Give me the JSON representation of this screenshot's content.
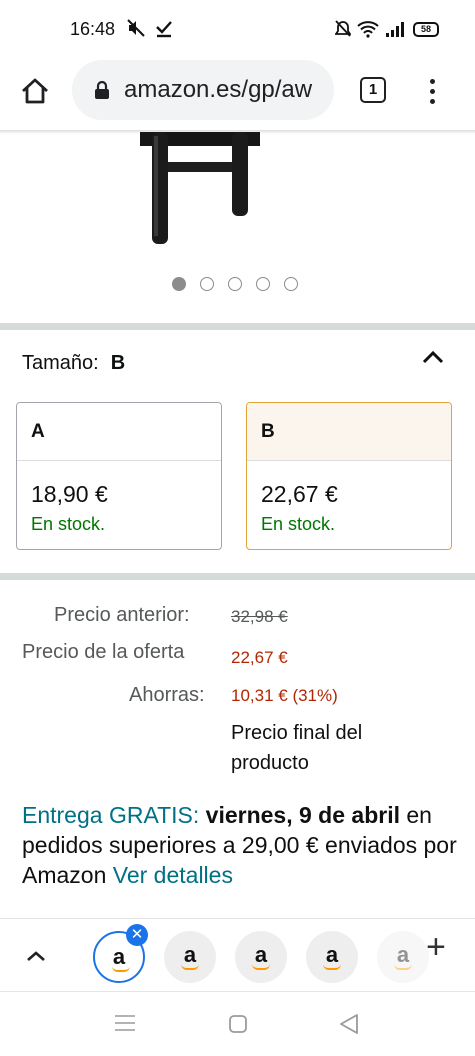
{
  "status_bar": {
    "time": "16:48",
    "left_icons": [
      "mute-icon",
      "download-done-icon"
    ],
    "right_icons": [
      "alarm-off-icon",
      "wifi-icon",
      "signal-icon",
      "battery-icon"
    ],
    "battery_level": "58"
  },
  "browser": {
    "url": "amazon.es/gp/aw",
    "tab_count": "1"
  },
  "carousel": {
    "total": 5,
    "active_index": 0
  },
  "size_selector": {
    "label": "Tamaño:",
    "selected_value": "B",
    "options": [
      {
        "name": "A",
        "price": "18,90 €",
        "stock": "En stock."
      },
      {
        "name": "B",
        "price": "22,67 €",
        "stock": "En stock."
      }
    ]
  },
  "pricing": {
    "previous_label": "Precio anterior:",
    "previous_value": "32,98 €",
    "offer_label": "Precio de la oferta",
    "offer_value": "22,67 €",
    "savings_label": "Ahorras:",
    "savings_value": "10,31 € (31%)",
    "final_note": "Precio final del producto"
  },
  "delivery": {
    "free_label": "Entrega GRATIS:",
    "date": "viernes, 9 de abril",
    "condition": "en pedidos superiores a 29,00 € enviados por Amazon",
    "details_link": "Ver detalles"
  },
  "tab_strip": {
    "tab_glyph": "a",
    "tabs_visible": 5
  },
  "colors": {
    "accent_blue": "#1a73e8",
    "stock_green": "#007600",
    "price_red": "#b12704",
    "link_teal": "#007185",
    "selected_border": "#e3a33b"
  }
}
